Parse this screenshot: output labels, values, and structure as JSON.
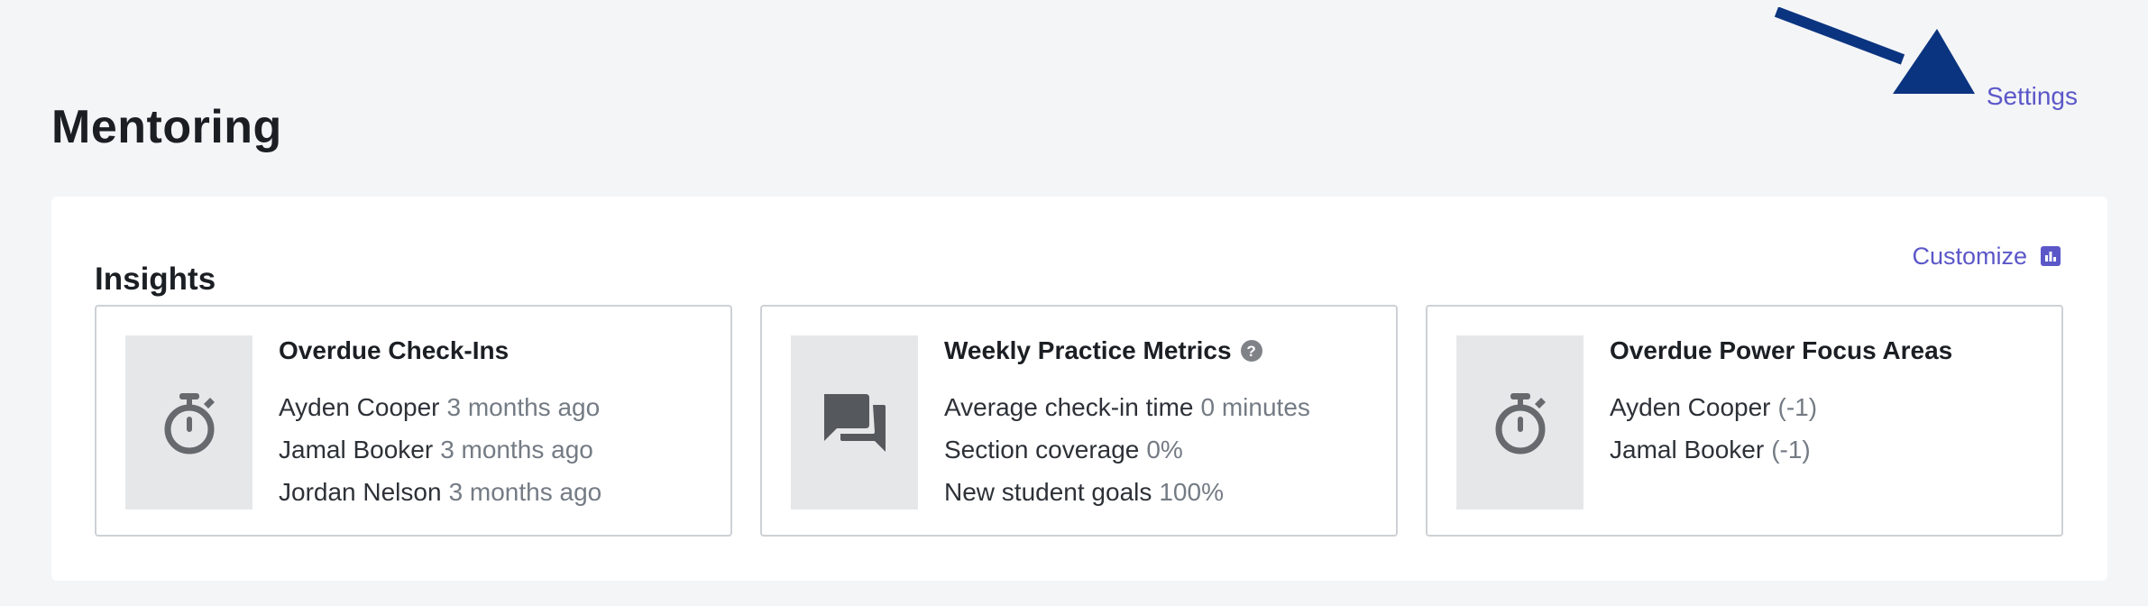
{
  "header": {
    "title": "Mentoring",
    "settings_label": "Settings"
  },
  "annotation": {
    "arrow_color": "#0b3480"
  },
  "insights": {
    "title": "Insights",
    "customize_label": "Customize",
    "accent_color": "#5b57c8",
    "cards": [
      {
        "title": "Overdue Check-Ins",
        "icon": "stopwatch-icon",
        "rows": [
          {
            "label": "Ayden Cooper",
            "value": "3 months ago"
          },
          {
            "label": "Jamal Booker",
            "value": "3 months ago"
          },
          {
            "label": "Jordan Nelson",
            "value": "3 months ago"
          }
        ]
      },
      {
        "title": "Weekly Practice Metrics",
        "icon": "chat-bubbles-icon",
        "help_icon": "help-icon",
        "help_glyph": "?",
        "rows": [
          {
            "label": "Average check-in time",
            "value": "0 minutes"
          },
          {
            "label": "Section coverage",
            "value": "0%"
          },
          {
            "label": "New student goals",
            "value": "100%"
          }
        ]
      },
      {
        "title": "Overdue Power Focus Areas",
        "icon": "stopwatch-icon",
        "rows": [
          {
            "label": "Ayden Cooper",
            "value": "(-1)"
          },
          {
            "label": "Jamal Booker",
            "value": "(-1)"
          }
        ]
      }
    ]
  }
}
